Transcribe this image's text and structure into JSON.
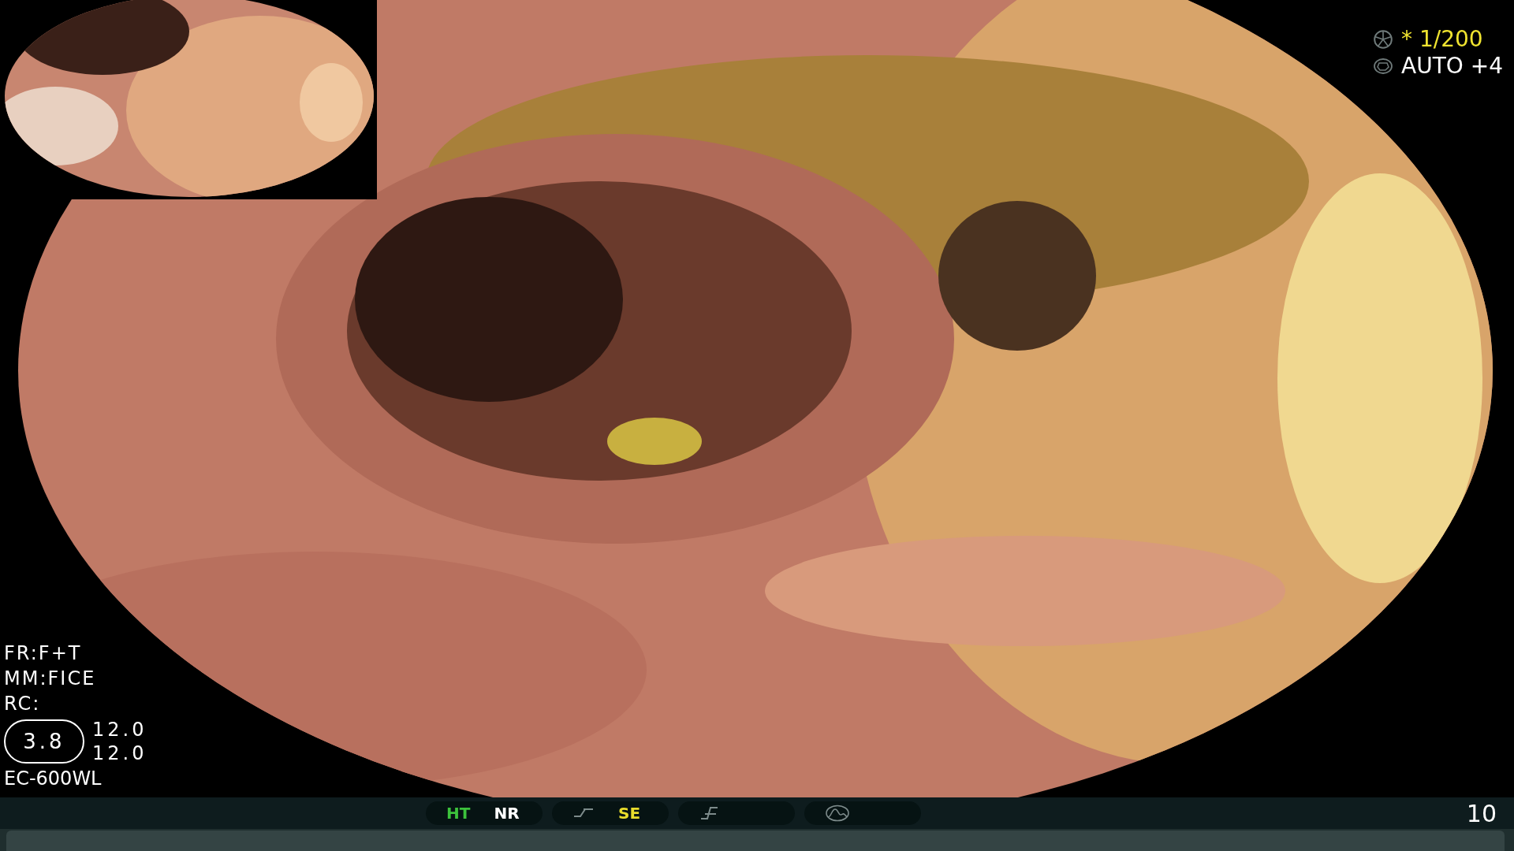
{
  "exposure": [
    {
      "text": "* 1/200",
      "color": "#f0e430"
    },
    {
      "text": "AUTO +4",
      "color": "#ffffff"
    }
  ],
  "settings": {
    "lines": [
      "FR:F+T",
      "MM:FICE",
      "RC:"
    ],
    "zoom": "3.8",
    "values": [
      "12.0",
      "12.0"
    ],
    "scope": "EC-600WL"
  },
  "status_bar": {
    "groups": [
      {
        "items": [
          {
            "kind": "text",
            "text": "HT",
            "color": "#3cc23c"
          },
          {
            "kind": "text",
            "text": "NR",
            "color": "#ffffff"
          }
        ]
      },
      {
        "items": [
          {
            "kind": "icon"
          },
          {
            "kind": "text",
            "text": "SE",
            "color": "#e8dc2c"
          }
        ]
      },
      {
        "items": [
          {
            "kind": "icon"
          }
        ]
      },
      {
        "items": [
          {
            "kind": "icon"
          }
        ]
      }
    ],
    "number": "10"
  }
}
